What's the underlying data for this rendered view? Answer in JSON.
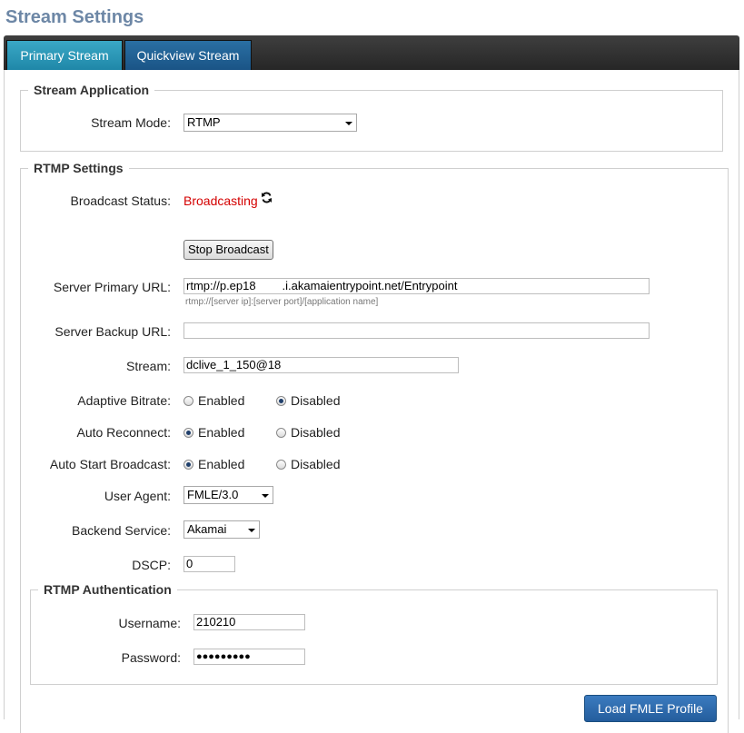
{
  "page": {
    "title": "Stream Settings"
  },
  "tabs": [
    {
      "label": "Primary Stream",
      "active": true
    },
    {
      "label": "Quickview Stream",
      "active": false
    }
  ],
  "stream_application": {
    "legend": "Stream Application",
    "mode_label": "Stream Mode:",
    "mode_value": "RTMP"
  },
  "rtmp_settings": {
    "legend": "RTMP Settings",
    "broadcast_status_label": "Broadcast Status:",
    "broadcast_status_value": "Broadcasting",
    "status_color": "#d40000",
    "refresh_icon": "refresh-icon",
    "stop_button": "Stop Broadcast",
    "primary_url_label": "Server Primary URL:",
    "primary_url_value": "rtmp://p.ep18        .i.akamaientrypoint.net/Entrypoint",
    "primary_url_hint": "rtmp://[server ip]:[server port]/[application name]",
    "backup_url_label": "Server Backup URL:",
    "backup_url_value": "",
    "stream_label": "Stream:",
    "stream_value": "dclive_1_150@18",
    "adaptive_bitrate_label": "Adaptive Bitrate:",
    "adaptive_bitrate": "Disabled",
    "auto_reconnect_label": "Auto Reconnect:",
    "auto_reconnect": "Enabled",
    "auto_start_label": "Auto Start Broadcast:",
    "auto_start": "Enabled",
    "enabled_label": "Enabled",
    "disabled_label": "Disabled",
    "user_agent_label": "User Agent:",
    "user_agent_value": "FMLE/3.0",
    "backend_label": "Backend Service:",
    "backend_value": "Akamai",
    "dscp_label": "DSCP:",
    "dscp_value": "0"
  },
  "rtmp_auth": {
    "legend": "RTMP Authentication",
    "username_label": "Username:",
    "username_value": "210210",
    "password_label": "Password:",
    "password_value": "●●●●●●●●●"
  },
  "actions": {
    "load_fmle": "Load FMLE Profile"
  },
  "colors": {
    "title": "#6d87a6",
    "tab_active": "#2a97b8",
    "tab_inactive": "#1f5f95",
    "button_blue": "#2e6aac"
  }
}
